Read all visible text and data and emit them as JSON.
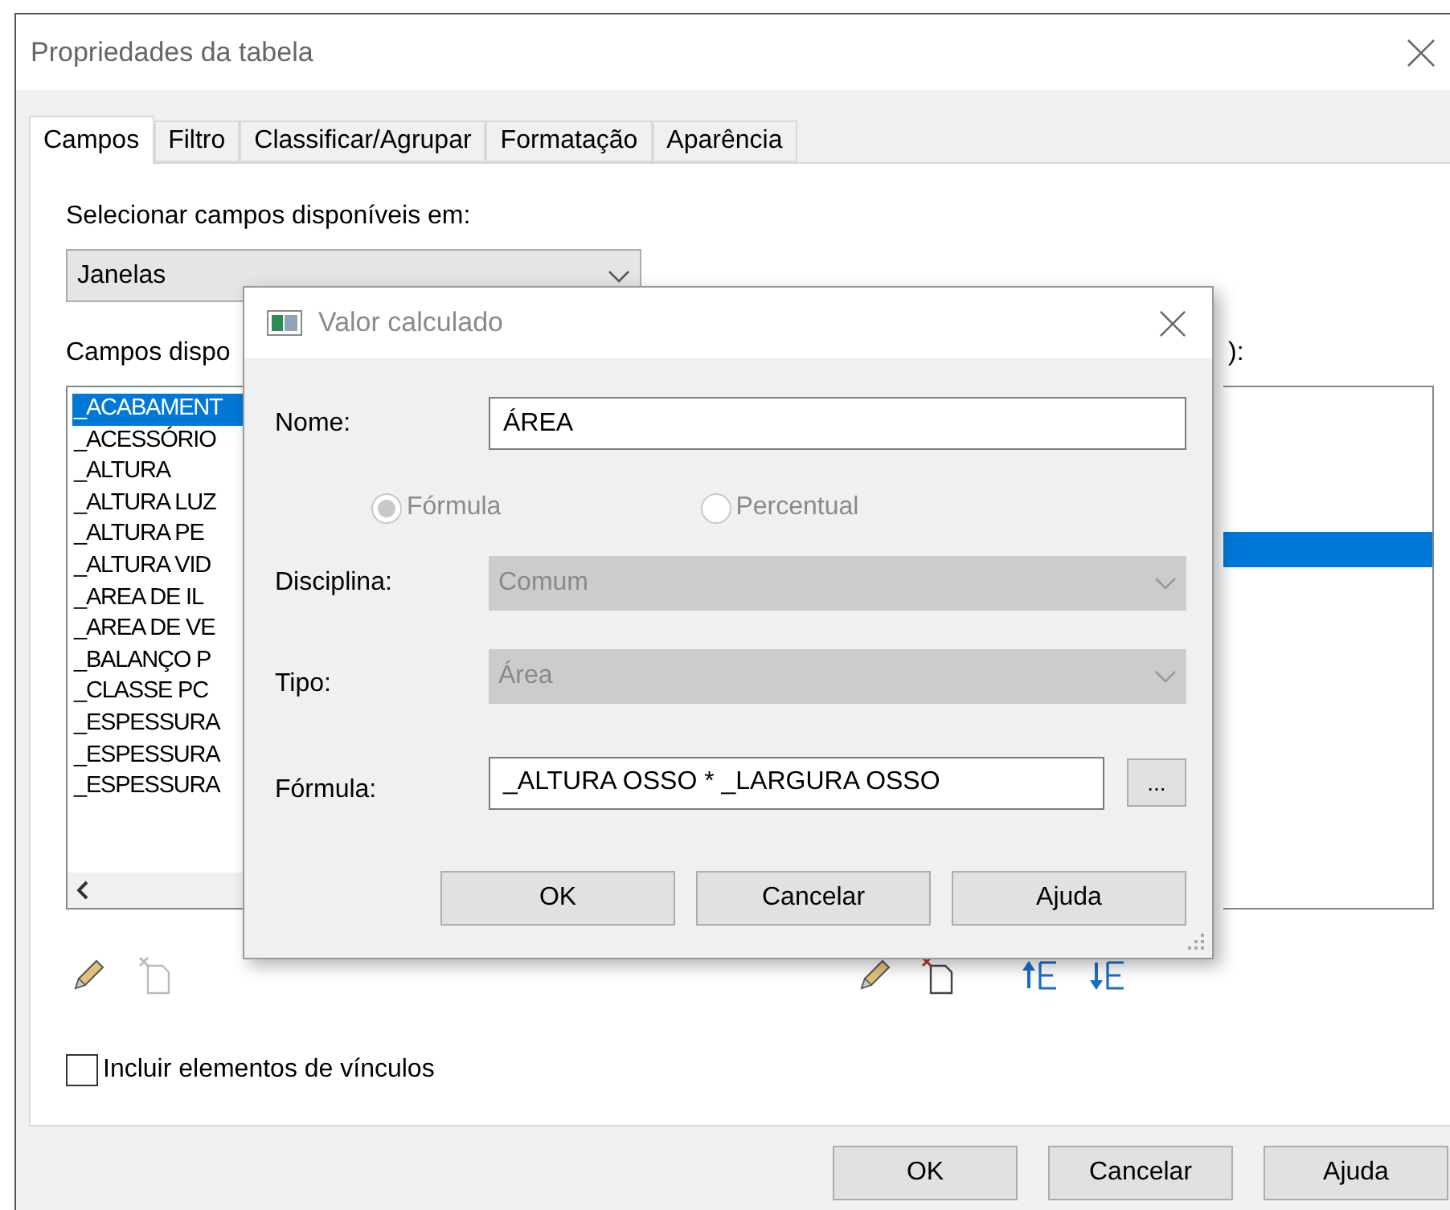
{
  "window": {
    "title": "Propriedades da tabela"
  },
  "tabs": [
    {
      "label": "Campos",
      "selected": true
    },
    {
      "label": "Filtro",
      "selected": false
    },
    {
      "label": "Classificar/Agrupar",
      "selected": false
    },
    {
      "label": "Formatação",
      "selected": false
    },
    {
      "label": "Aparência",
      "selected": false
    }
  ],
  "source": {
    "label": "Selecionar campos disponíveis em:",
    "value": "Janelas"
  },
  "available_fields": {
    "label": "Campos dispo",
    "items": [
      {
        "text": "_ACABAMENT",
        "selected": true
      },
      {
        "text": "_ACESSÓRIO",
        "selected": false
      },
      {
        "text": "_ALTURA",
        "selected": false
      },
      {
        "text": "_ALTURA LUZ",
        "selected": false
      },
      {
        "text": "_ALTURA PE",
        "selected": false
      },
      {
        "text": "_ALTURA VID",
        "selected": false
      },
      {
        "text": "_AREA DE IL",
        "selected": false
      },
      {
        "text": "_AREA DE VE",
        "selected": false
      },
      {
        "text": "_BALANÇO P",
        "selected": false
      },
      {
        "text": "_CLASSE PC",
        "selected": false
      },
      {
        "text": "_ESPESSURA",
        "selected": false
      },
      {
        "text": "_ESPESSURA",
        "selected": false
      },
      {
        "text": "_ESPESSURA",
        "selected": false
      }
    ]
  },
  "scheduled_fields": {
    "label": "):",
    "rows": [
      {
        "selected": false
      },
      {
        "selected": false
      },
      {
        "selected": false
      },
      {
        "selected": false
      },
      {
        "selected": true
      }
    ]
  },
  "include_links": {
    "label": "Incluir elementos de vínculos",
    "checked": false
  },
  "buttons": [
    "OK",
    "Cancelar",
    "Ajuda"
  ],
  "dialog": {
    "title": "Valor calculado",
    "name": {
      "label": "Nome:",
      "value": "ÁREA"
    },
    "radios": [
      {
        "label": "Fórmula",
        "selected": true
      },
      {
        "label": "Percentual",
        "selected": false
      }
    ],
    "discipline": {
      "label": "Disciplina:",
      "value": "Comum",
      "disabled": true
    },
    "type": {
      "label": "Tipo:",
      "value": "Área",
      "disabled": true
    },
    "formula": {
      "label": "Fórmula:",
      "value": "_ALTURA OSSO * _LARGURA OSSO",
      "browse": "..."
    },
    "buttons": [
      "OK",
      "Cancelar",
      "Ajuda"
    ]
  }
}
